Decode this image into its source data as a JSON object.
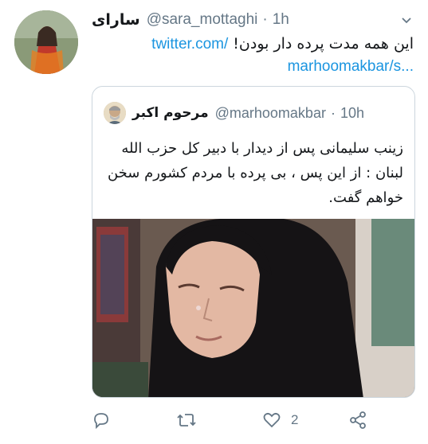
{
  "tweet": {
    "display_name": "سارای",
    "handle": "@sara_mottaghi",
    "time": "1h",
    "text": "این همه مدت پرده دار بودن!",
    "link_part1": "twitter.com/",
    "link_part2": "marhoomakbar/s..."
  },
  "quoted": {
    "display_name": "مرحوم اکبر",
    "handle": "@marhoomakbar",
    "time": "10h",
    "text": "زینب سلیمانی پس از دیدار با دبیر کل حزب الله لبنان : از این پس ، بی پرده با مردم کشورم سخن خواهم گفت."
  },
  "actions": {
    "reply_icon": "reply-icon",
    "retweet_icon": "retweet-icon",
    "like_icon": "heart-icon",
    "like_count": "2",
    "share_icon": "share-icon"
  },
  "colors": {
    "link": "#1b95e0",
    "secondary": "#657786",
    "border": "#ccd6dd"
  }
}
